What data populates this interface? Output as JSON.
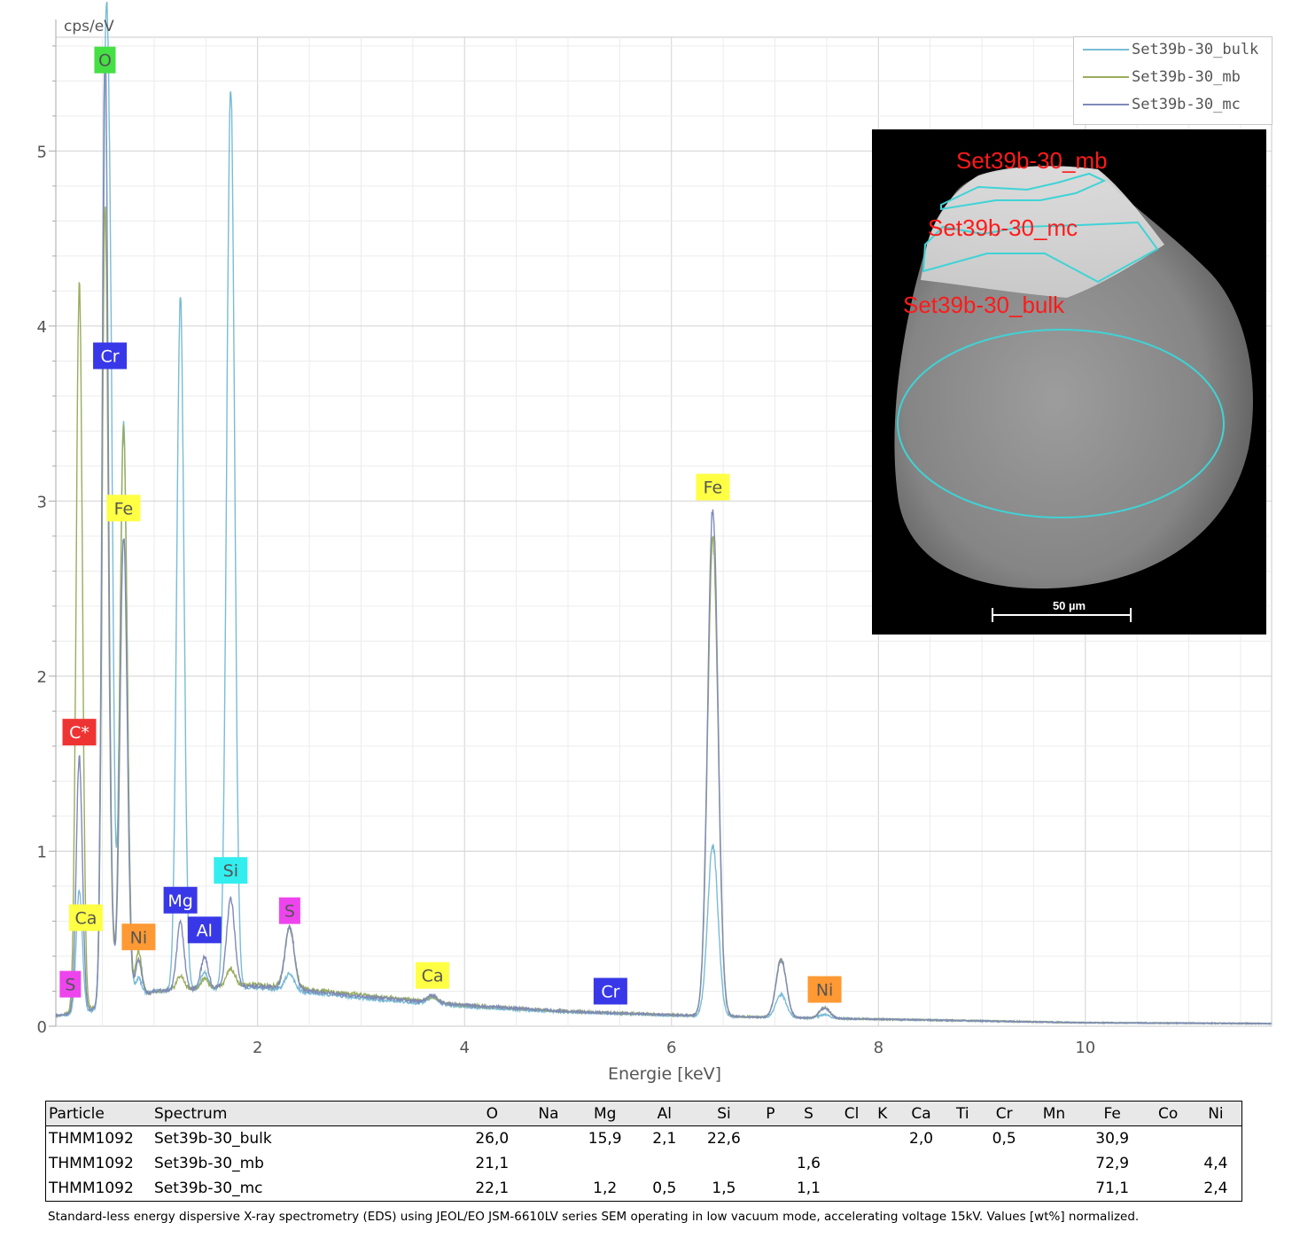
{
  "chart_data": {
    "type": "line",
    "ylabel": "cps/eV",
    "xlabel": "Energie [keV]",
    "xlim": [
      0.05,
      11.8
    ],
    "ylim": [
      0,
      5.65
    ],
    "xticks": [
      2,
      4,
      6,
      8,
      10
    ],
    "yticks": [
      0,
      1,
      2,
      3,
      4,
      5
    ],
    "grid": true,
    "legend_position": "top-right",
    "series": [
      {
        "name": "Set39b-30_bulk",
        "color": "#79bcd6",
        "background": [
          [
            0.05,
            0.06
          ],
          [
            0.3,
            0.07
          ],
          [
            1.0,
            0.2
          ],
          [
            2.0,
            0.22
          ],
          [
            3.0,
            0.16
          ],
          [
            4.0,
            0.11
          ],
          [
            5.0,
            0.08
          ],
          [
            6.0,
            0.06
          ],
          [
            7.0,
            0.05
          ],
          [
            8.0,
            0.04
          ],
          [
            9.0,
            0.03
          ],
          [
            10.0,
            0.02
          ],
          [
            11.8,
            0.015
          ]
        ],
        "peaks": [
          [
            0.277,
            0.7,
            0.03
          ],
          [
            0.525,
            4.3,
            0.028
          ],
          [
            0.573,
            3.7,
            0.03
          ],
          [
            0.705,
            3.3,
            0.035
          ],
          [
            0.85,
            0.1,
            0.03
          ],
          [
            1.254,
            3.95,
            0.035
          ],
          [
            1.487,
            0.1,
            0.035
          ],
          [
            1.74,
            5.15,
            0.038
          ],
          [
            2.31,
            0.1,
            0.045
          ],
          [
            3.69,
            0.04,
            0.05
          ],
          [
            6.4,
            0.98,
            0.05
          ],
          [
            7.06,
            0.13,
            0.05
          ],
          [
            7.48,
            0.02,
            0.05
          ]
        ]
      },
      {
        "name": "Set39b-30_mb",
        "color": "#99ad5c",
        "background": [
          [
            0.05,
            0.06
          ],
          [
            0.3,
            0.09
          ],
          [
            1.0,
            0.2
          ],
          [
            2.0,
            0.24
          ],
          [
            3.0,
            0.18
          ],
          [
            4.0,
            0.12
          ],
          [
            5.0,
            0.085
          ],
          [
            6.0,
            0.065
          ],
          [
            7.0,
            0.05
          ],
          [
            8.0,
            0.04
          ],
          [
            9.0,
            0.03
          ],
          [
            10.0,
            0.02
          ],
          [
            11.8,
            0.015
          ]
        ],
        "peaks": [
          [
            0.277,
            4.15,
            0.03
          ],
          [
            0.525,
            4.45,
            0.028
          ],
          [
            0.573,
            0.5,
            0.03
          ],
          [
            0.705,
            3.25,
            0.035
          ],
          [
            0.85,
            0.25,
            0.03
          ],
          [
            1.254,
            0.08,
            0.035
          ],
          [
            1.487,
            0.05,
            0.035
          ],
          [
            1.74,
            0.1,
            0.04
          ],
          [
            2.31,
            0.34,
            0.045
          ],
          [
            3.69,
            0.03,
            0.05
          ],
          [
            6.4,
            2.72,
            0.05
          ],
          [
            7.06,
            0.33,
            0.05
          ],
          [
            7.48,
            0.06,
            0.05
          ]
        ]
      },
      {
        "name": "Set39b-30_mc",
        "color": "#7f8ab8",
        "background": [
          [
            0.05,
            0.06
          ],
          [
            0.3,
            0.08
          ],
          [
            1.0,
            0.2
          ],
          [
            2.0,
            0.23
          ],
          [
            3.0,
            0.17
          ],
          [
            4.0,
            0.12
          ],
          [
            5.0,
            0.085
          ],
          [
            6.0,
            0.065
          ],
          [
            7.0,
            0.05
          ],
          [
            8.0,
            0.04
          ],
          [
            9.0,
            0.03
          ],
          [
            10.0,
            0.02
          ],
          [
            11.8,
            0.015
          ]
        ],
        "peaks": [
          [
            0.277,
            1.45,
            0.03
          ],
          [
            0.525,
            5.35,
            0.028
          ],
          [
            0.573,
            0.6,
            0.03
          ],
          [
            0.705,
            2.65,
            0.035
          ],
          [
            0.85,
            0.2,
            0.03
          ],
          [
            1.254,
            0.38,
            0.035
          ],
          [
            1.487,
            0.18,
            0.035
          ],
          [
            1.74,
            0.5,
            0.04
          ],
          [
            2.31,
            0.35,
            0.045
          ],
          [
            3.69,
            0.04,
            0.05
          ],
          [
            6.4,
            2.9,
            0.05
          ],
          [
            7.06,
            0.33,
            0.05
          ],
          [
            7.48,
            0.06,
            0.05
          ]
        ]
      }
    ],
    "element_labels": [
      {
        "text": "O",
        "x": 0.525,
        "y": 5.52,
        "color": "#44e044"
      },
      {
        "text": "Cr",
        "x": 0.573,
        "y": 3.83,
        "color": "#3838e8"
      },
      {
        "text": "Fe",
        "x": 0.705,
        "y": 2.96,
        "color": "#ffff44"
      },
      {
        "text": "C*",
        "x": 0.277,
        "y": 1.68,
        "color": "#ee3333"
      },
      {
        "text": "Ca",
        "x": 0.341,
        "y": 0.62,
        "color": "#ffff44"
      },
      {
        "text": "S",
        "x": 0.19,
        "y": 0.24,
        "color": "#ee44ee"
      },
      {
        "text": "Ni",
        "x": 0.85,
        "y": 0.51,
        "color": "#ff9933"
      },
      {
        "text": "Mg",
        "x": 1.254,
        "y": 0.72,
        "color": "#3838e8"
      },
      {
        "text": "Al",
        "x": 1.487,
        "y": 0.55,
        "color": "#3838e8"
      },
      {
        "text": "Si",
        "x": 1.74,
        "y": 0.89,
        "color": "#33eeee"
      },
      {
        "text": "S",
        "x": 2.31,
        "y": 0.66,
        "color": "#ee44ee"
      },
      {
        "text": "Ca",
        "x": 3.69,
        "y": 0.29,
        "color": "#ffff44"
      },
      {
        "text": "Cr",
        "x": 5.41,
        "y": 0.2,
        "color": "#3838e8"
      },
      {
        "text": "Fe",
        "x": 6.4,
        "y": 3.08,
        "color": "#ffff44"
      },
      {
        "text": "Ni",
        "x": 7.48,
        "y": 0.21,
        "color": "#ff9933"
      }
    ]
  },
  "inset": {
    "labels": [
      "Set39b-30_mb",
      "Set39b-30_mc",
      "Set39b-30_bulk"
    ],
    "scale_bar": "50 µm",
    "outline_color": "#3fd3d6"
  },
  "table": {
    "headers": [
      "Particle",
      "Spectrum",
      "O",
      "Na",
      "Mg",
      "Al",
      "Si",
      "P",
      "S",
      "Cl",
      "K",
      "Ca",
      "Ti",
      "Cr",
      "Mn",
      "Fe",
      "Co",
      "Ni"
    ],
    "rows": [
      [
        "THMM1092",
        "Set39b-30_bulk",
        "26,0",
        "",
        "15,9",
        "2,1",
        "22,6",
        "",
        "",
        "",
        "",
        "2,0",
        "",
        "0,5",
        "",
        "30,9",
        "",
        ""
      ],
      [
        "THMM1092",
        "Set39b-30_mb",
        "21,1",
        "",
        "",
        "",
        "",
        "",
        "1,6",
        "",
        "",
        "",
        "",
        "",
        "",
        "72,9",
        "",
        "4,4"
      ],
      [
        "THMM1092",
        "Set39b-30_mc",
        "22,1",
        "",
        "1,2",
        "0,5",
        "1,5",
        "",
        "1,1",
        "",
        "",
        "",
        "",
        "",
        "",
        "71,1",
        "",
        "2,4"
      ]
    ]
  },
  "footnote": "Standard-less energy dispersive X-ray spectrometry (EDS) using JEOL/EO JSM-6610LV series SEM operating in low vacuum mode, accelerating voltage 15kV. Values [wt%] normalized."
}
